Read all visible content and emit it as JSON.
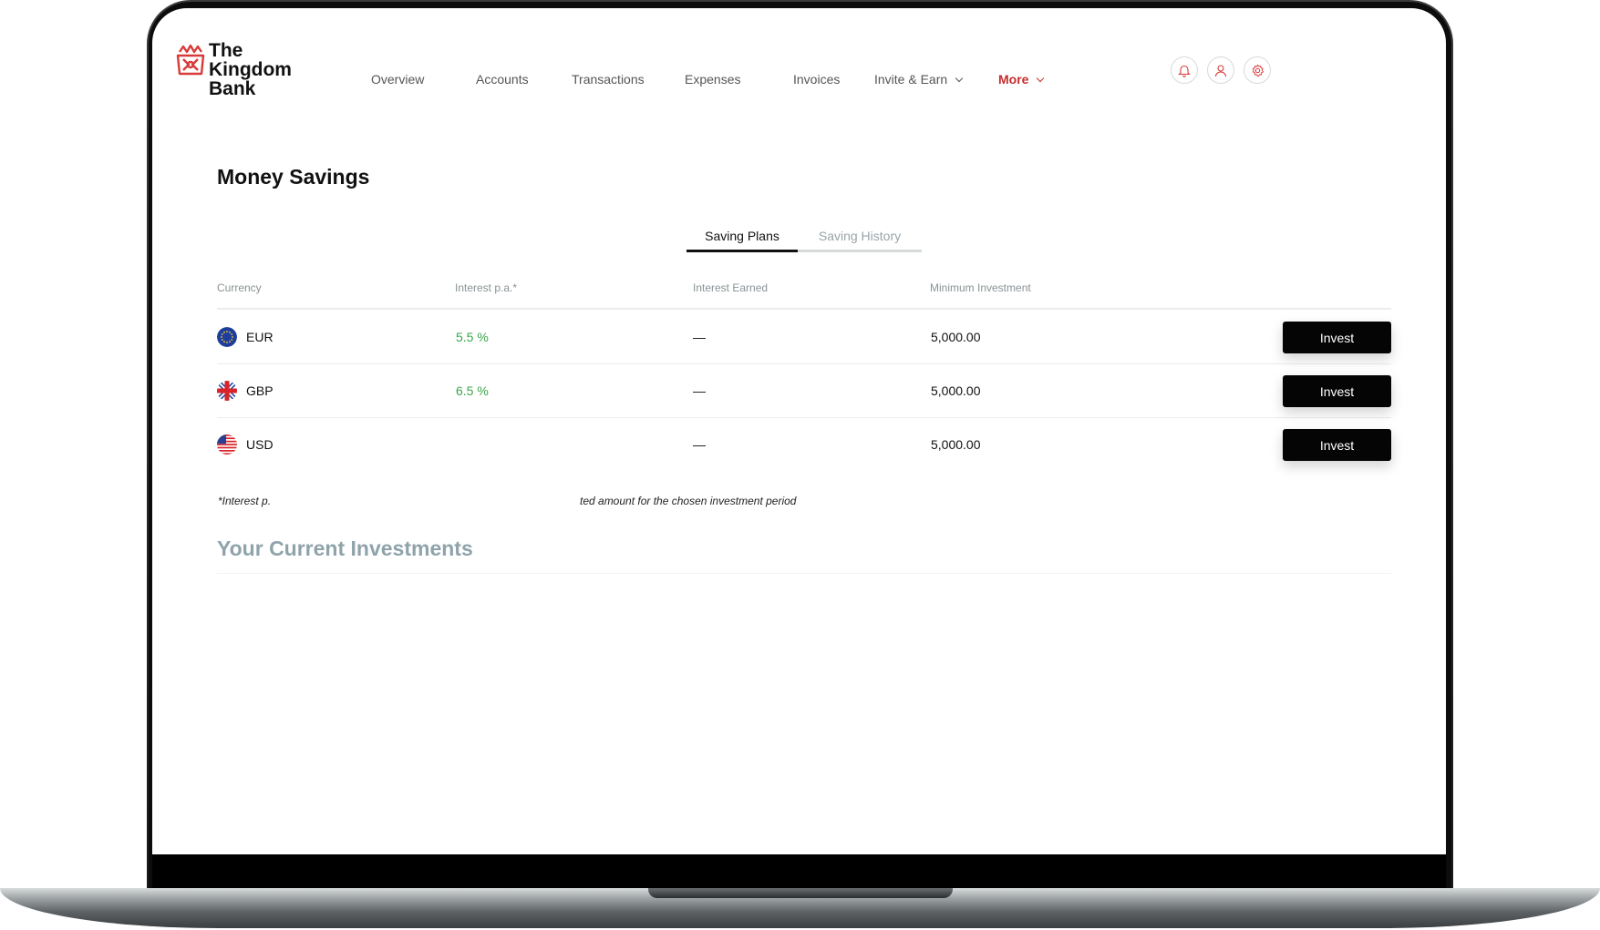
{
  "brand": {
    "name_lines": [
      "The",
      "Kingdom",
      "Bank"
    ],
    "accent": "#c42d2d"
  },
  "nav": {
    "items": [
      {
        "label": "Overview"
      },
      {
        "label": "Accounts"
      },
      {
        "label": "Transactions"
      },
      {
        "label": "Expenses"
      },
      {
        "label": "Invoices"
      },
      {
        "label": "Invite & Earn"
      },
      {
        "label": "More"
      }
    ],
    "active": "More"
  },
  "header_icons": [
    "bell-icon",
    "user-icon",
    "settings-icon"
  ],
  "page": {
    "title": "Money Savings"
  },
  "tabs": [
    {
      "label": "Saving Plans"
    },
    {
      "label": "Saving History"
    }
  ],
  "table": {
    "columns": [
      "Currency",
      "Interest p.a.*",
      "Interest Earned",
      "Minimum Investment"
    ],
    "rows": [
      {
        "currency": "EUR",
        "flag": "eu-flag-icon",
        "interest": "5.5 %",
        "earned": "—",
        "minimum": "5,000.00",
        "action": "Invest"
      },
      {
        "currency": "GBP",
        "flag": "uk-flag-icon",
        "interest": "6.5 %",
        "earned": "—",
        "minimum": "5,000.00",
        "action": "Invest"
      },
      {
        "currency": "USD",
        "flag": "us-flag-icon",
        "interest": "",
        "earned": "—",
        "minimum": "5,000.00",
        "action": "Invest"
      }
    ]
  },
  "footnote": {
    "left": "*Interest p.",
    "right": "ted amount for the chosen investment period"
  },
  "section": {
    "title": "Your Current Investments"
  }
}
